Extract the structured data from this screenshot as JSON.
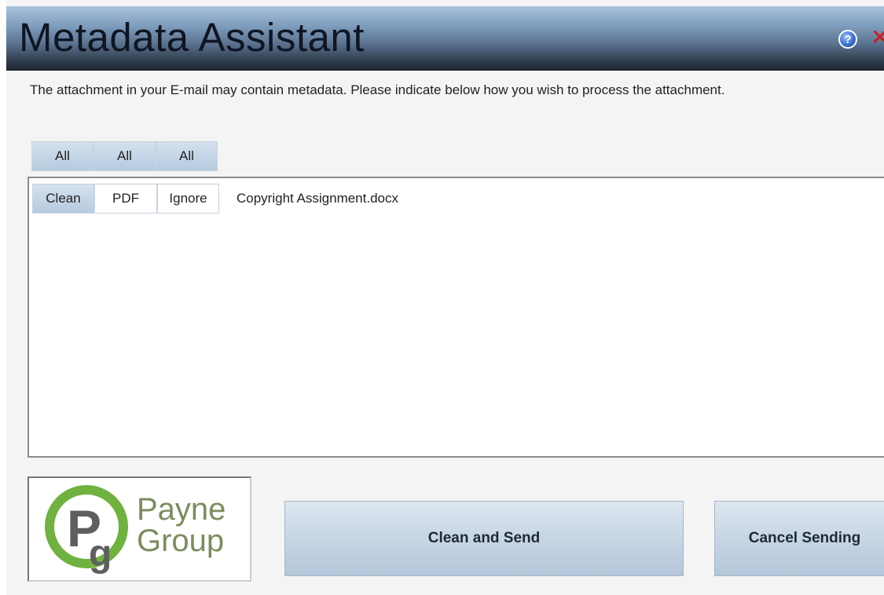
{
  "window": {
    "title": "Metadata Assistant",
    "help_glyph": "?",
    "close_glyph": "✕"
  },
  "message": "The attachment in your E-mail may contain metadata. Please indicate below how you wish to process the attachment.",
  "all_buttons": [
    "All",
    "All",
    "All"
  ],
  "attachments": [
    {
      "options": [
        "Clean",
        "PDF",
        "Ignore"
      ],
      "selected": "Clean",
      "filename": "Copyright Assignment.docx"
    }
  ],
  "logo": {
    "text_line1": "Payne",
    "text_line2": "Group",
    "icon": "payne-group-logo-icon",
    "colors": {
      "circle": "#6fb23f",
      "text": "#7c8c5f",
      "letter": "#5f5f5f"
    }
  },
  "actions": {
    "clean_send_label": "Clean and Send",
    "cancel_label": "Cancel Sending"
  },
  "colors": {
    "accent": "#b7cadf",
    "title_bar_dark": "#1c232c",
    "close": "#d01818"
  }
}
